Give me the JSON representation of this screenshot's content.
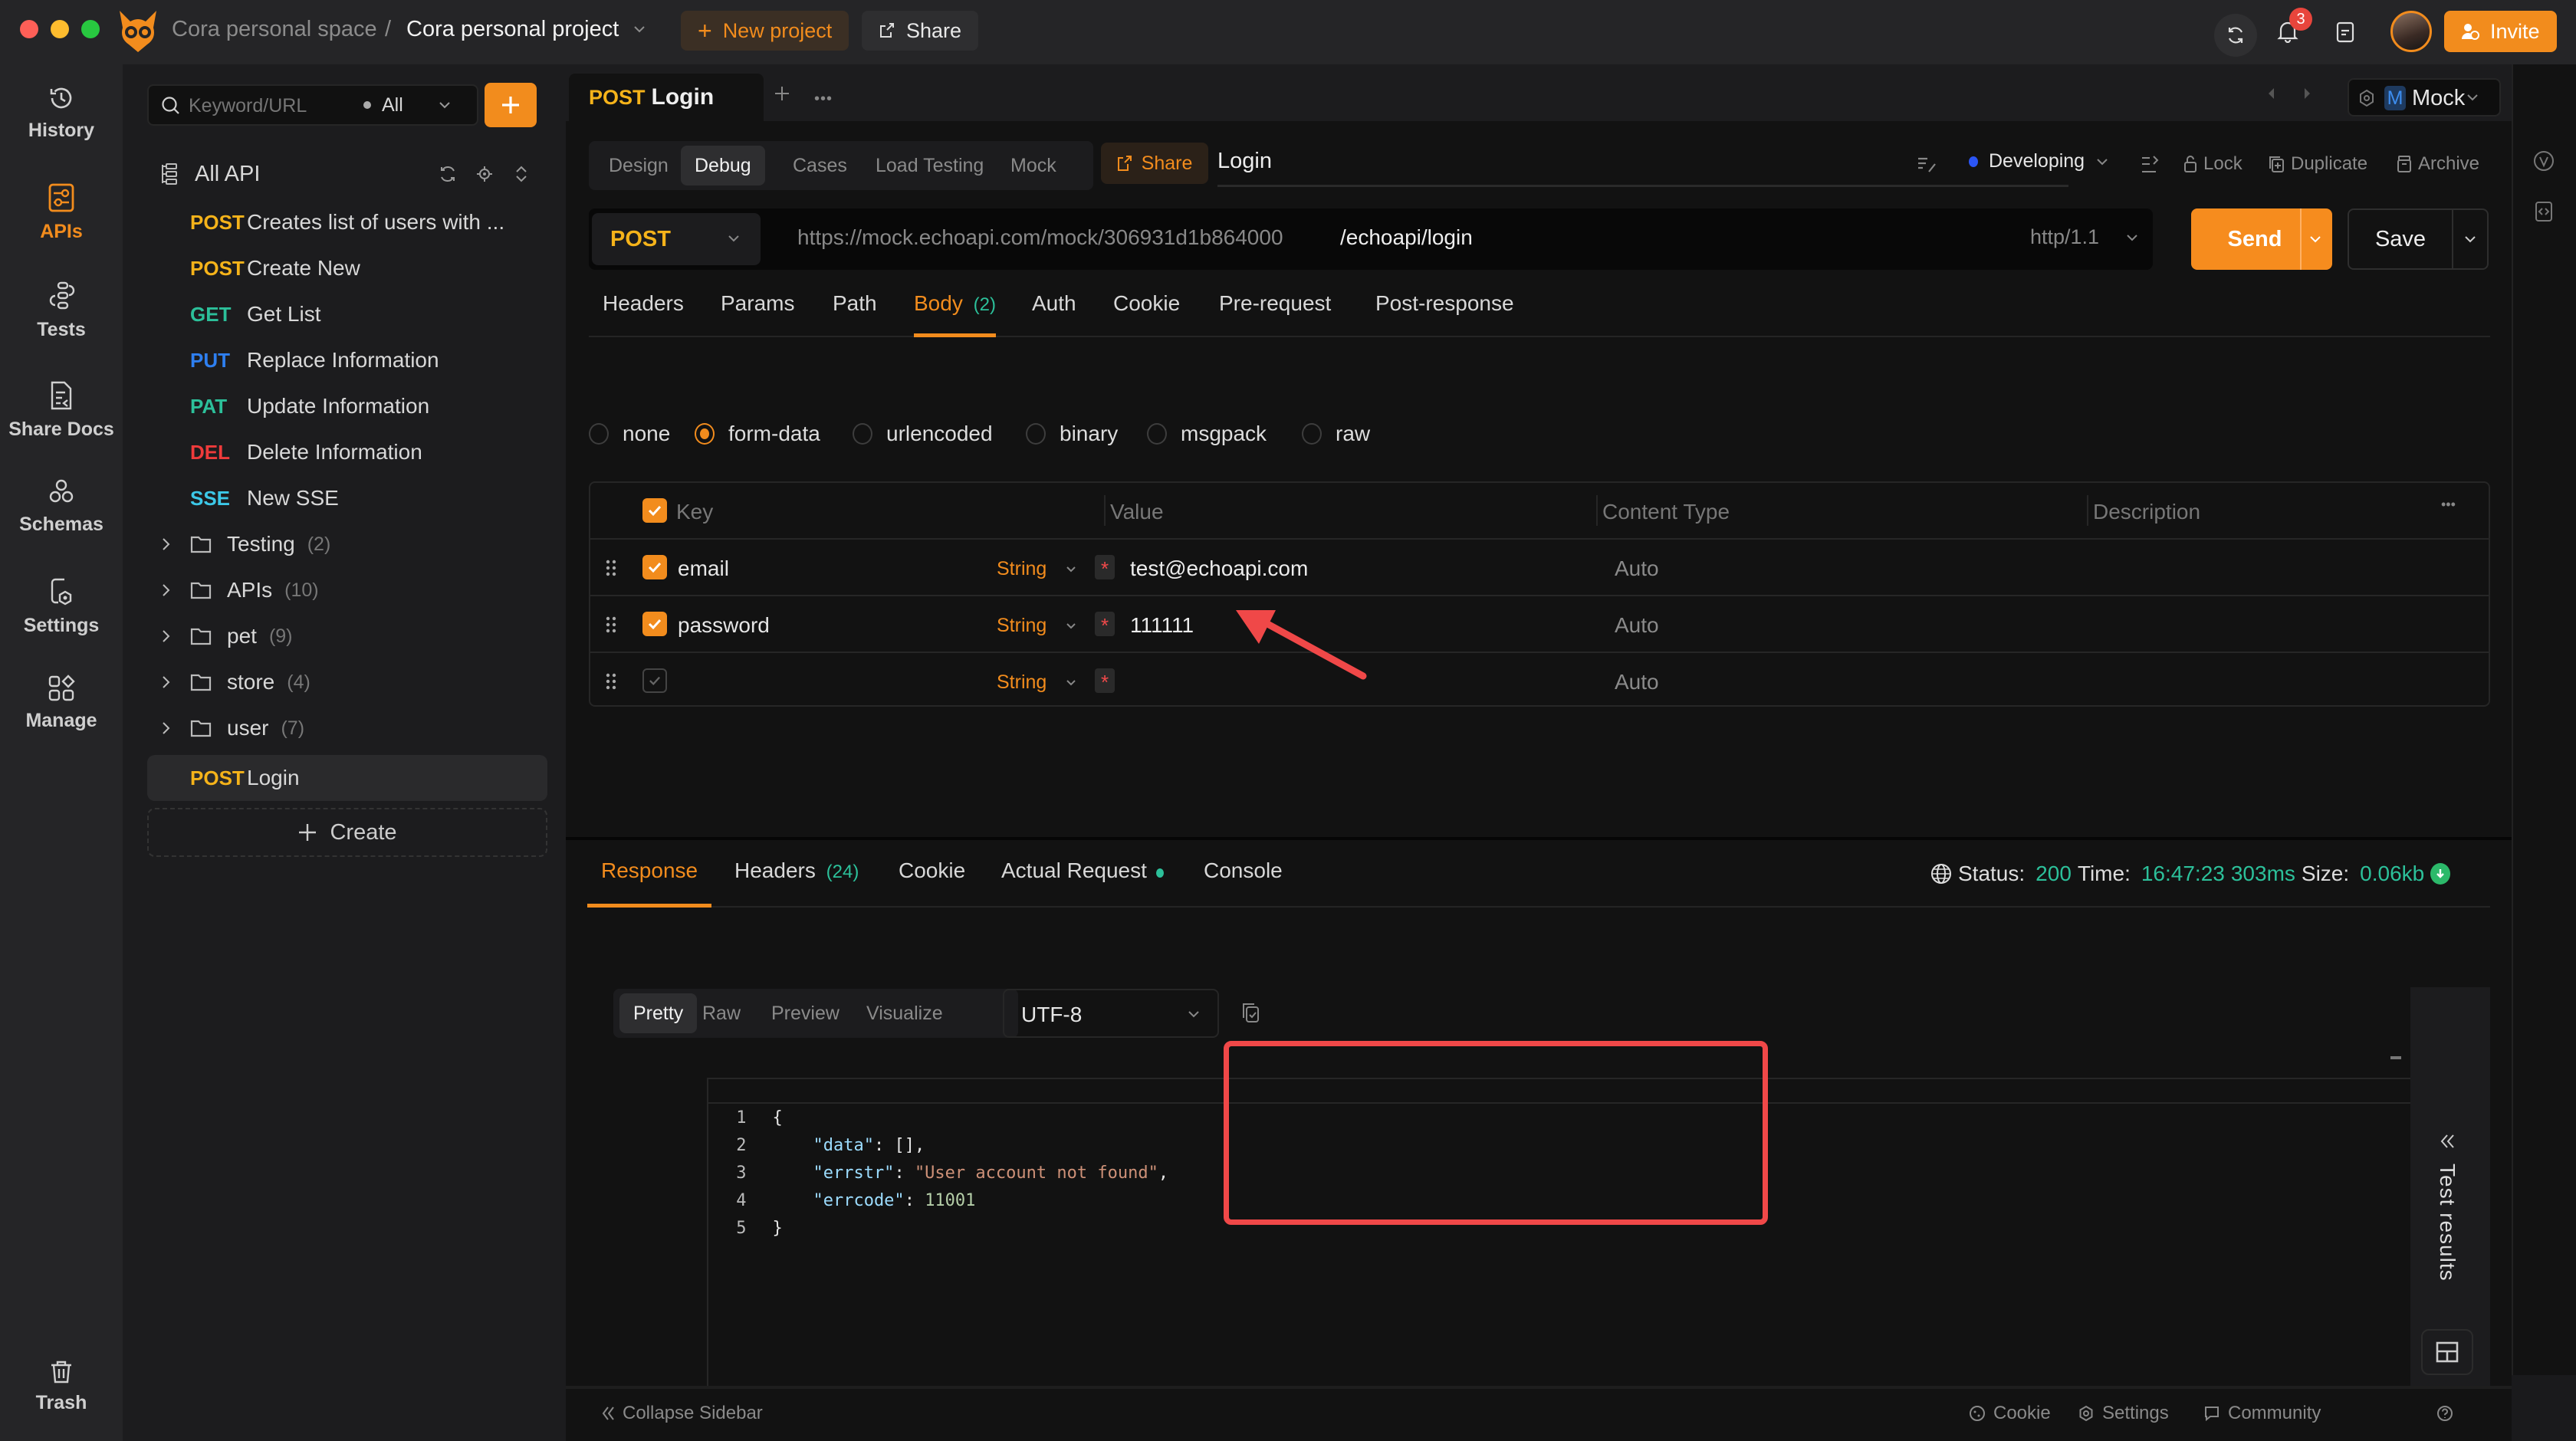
{
  "titlebar": {
    "workspace": "Cora personal space",
    "separator": "/",
    "project": "Cora personal project",
    "new_project": "New project",
    "share": "Share",
    "notification_count": "3",
    "invite": "Invite"
  },
  "leftnav": {
    "items": [
      {
        "label": "History",
        "icon": "history-icon"
      },
      {
        "label": "APIs",
        "icon": "apis-icon",
        "active": true
      },
      {
        "label": "Tests",
        "icon": "tests-icon"
      },
      {
        "label": "Share Docs",
        "icon": "share-docs-icon"
      },
      {
        "label": "Schemas",
        "icon": "schemas-icon"
      },
      {
        "label": "Settings",
        "icon": "settings-icon"
      },
      {
        "label": "Manage",
        "icon": "manage-icon"
      }
    ],
    "trash": "Trash"
  },
  "tree": {
    "search_placeholder": "Keyword/URL",
    "filter": "All",
    "root_label": "All API",
    "apis": [
      {
        "method": "POST",
        "name": "Creates list of users with ...",
        "color": "#f5b31a"
      },
      {
        "method": "POST",
        "name": "Create New",
        "color": "#f5b31a"
      },
      {
        "method": "GET",
        "name": "Get List",
        "color": "#2cc09a"
      },
      {
        "method": "PUT",
        "name": "Replace Information",
        "color": "#2e7ff0"
      },
      {
        "method": "PAT",
        "name": "Update Information",
        "color": "#2cc09a"
      },
      {
        "method": "DEL",
        "name": "Delete Information",
        "color": "#ef3b3b"
      },
      {
        "method": "SSE",
        "name": "New SSE",
        "color": "#3cc8e8"
      }
    ],
    "folders": [
      {
        "name": "Testing",
        "count": "(2)"
      },
      {
        "name": "APIs",
        "count": "(10)"
      },
      {
        "name": "pet",
        "count": "(9)"
      },
      {
        "name": "store",
        "count": "(4)"
      },
      {
        "name": "user",
        "count": "(7)"
      }
    ],
    "selected": {
      "method": "POST",
      "name": "Login"
    },
    "create": "Create"
  },
  "tab": {
    "method": "POST",
    "name": "Login"
  },
  "env": {
    "badge": "M",
    "name": "Mock"
  },
  "mode_tabs": [
    "Design",
    "Debug",
    "Cases",
    "Load Testing",
    "Mock"
  ],
  "active_mode": "Debug",
  "share_label": "Share",
  "api_name": "Login",
  "status": {
    "label": "Developing",
    "color": "#2b55f5"
  },
  "actions": {
    "lock": "Lock",
    "duplicate": "Duplicate",
    "archive": "Archive"
  },
  "request": {
    "method": "POST",
    "base_url": "https://mock.echoapi.com/mock/306931d1b864000",
    "path": "/echoapi/login",
    "protocol": "http/1.1",
    "send": "Send",
    "save": "Save"
  },
  "req_tabs": [
    {
      "label": "Headers"
    },
    {
      "label": "Params"
    },
    {
      "label": "Path"
    },
    {
      "label": "Body",
      "count": "(2)",
      "active": true
    },
    {
      "label": "Auth"
    },
    {
      "label": "Cookie"
    },
    {
      "label": "Pre-request"
    },
    {
      "label": "Post-response"
    }
  ],
  "body_types": [
    "none",
    "form-data",
    "urlencoded",
    "binary",
    "msgpack",
    "raw"
  ],
  "body_type_selected": "form-data",
  "table": {
    "headers": {
      "key": "Key",
      "value": "Value",
      "content_type": "Content Type",
      "description": "Description"
    },
    "rows": [
      {
        "key": "email",
        "type": "String",
        "value": "test@echoapi.com",
        "content_type": "Auto",
        "checked": true
      },
      {
        "key": "password",
        "type": "String",
        "value": "111111",
        "content_type": "Auto",
        "checked": true
      },
      {
        "key": "",
        "type": "String",
        "value": "",
        "content_type": "Auto",
        "checked": false
      }
    ]
  },
  "response": {
    "tabs": [
      {
        "label": "Response",
        "active": true
      },
      {
        "label": "Headers",
        "count": "(24)"
      },
      {
        "label": "Cookie"
      },
      {
        "label": "Actual Request",
        "dot": true
      },
      {
        "label": "Console"
      }
    ],
    "status_label": "Status:",
    "status_value": "200",
    "time_label": "Time:",
    "time_value": "16:47:23",
    "duration": "303ms",
    "size_label": "Size:",
    "size_value": "0.06kb",
    "view_tabs": [
      "Pretty",
      "Raw",
      "Preview",
      "Visualize"
    ],
    "active_view": "Pretty",
    "encoding": "UTF-8",
    "lines": [
      {
        "n": "1",
        "indent": "",
        "key": "",
        "sep": "",
        "val": "{",
        "val_type": "punct",
        "trail": ""
      },
      {
        "n": "2",
        "indent": "    ",
        "key": "\"data\"",
        "sep": ": ",
        "val": "[]",
        "val_type": "punct",
        "trail": ","
      },
      {
        "n": "3",
        "indent": "    ",
        "key": "\"errstr\"",
        "sep": ": ",
        "val": "\"User account not found\"",
        "val_type": "string",
        "trail": ","
      },
      {
        "n": "4",
        "indent": "    ",
        "key": "\"errcode\"",
        "sep": ": ",
        "val": "11001",
        "val_type": "number",
        "trail": ""
      },
      {
        "n": "5",
        "indent": "",
        "key": "",
        "sep": "",
        "val": "}",
        "val_type": "punct",
        "trail": ""
      }
    ],
    "test_results": "Test results"
  },
  "footer": {
    "collapse": "Collapse Sidebar",
    "cookie": "Cookie",
    "settings": "Settings",
    "community": "Community"
  },
  "colors": {
    "accent": "#f28c1d",
    "success": "#2cc09a",
    "annotation": "#f04848"
  }
}
